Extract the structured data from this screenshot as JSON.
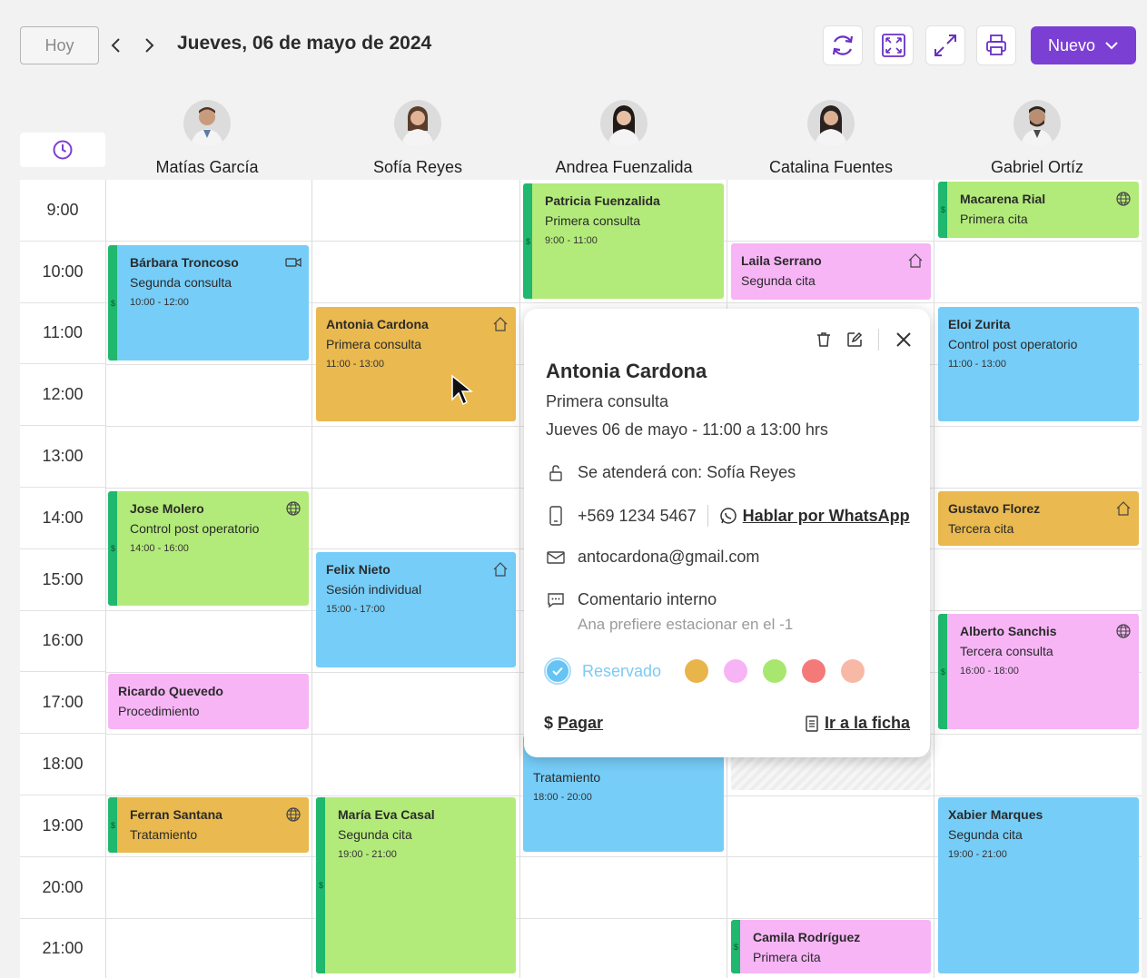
{
  "toolbar": {
    "today_label": "Hoy",
    "date_title": "Jueves, 06 de mayo de 2024",
    "new_label": "Nuevo",
    "icons": [
      "refresh-icon",
      "expand-selection-icon",
      "fullscreen-icon",
      "print-icon"
    ]
  },
  "doctors": [
    {
      "name": "Matías García"
    },
    {
      "name": "Sofía Reyes"
    },
    {
      "name": "Andrea Fuenzalida"
    },
    {
      "name": "Catalina Fuentes"
    },
    {
      "name": "Gabriel Ortíz"
    }
  ],
  "hours": [
    "9:00",
    "10:00",
    "11:00",
    "12:00",
    "13:00",
    "14:00",
    "15:00",
    "16:00",
    "17:00",
    "18:00",
    "19:00",
    "20:00",
    "21:00"
  ],
  "events": {
    "barbara": {
      "name": "Bárbara Troncoso",
      "type": "Segunda consulta",
      "time": "10:00 - 12:00",
      "icon": "video-icon"
    },
    "jose": {
      "name": "Jose Molero",
      "type": "Control post operatorio",
      "time": "14:00 - 16:00",
      "icon": "globe-icon"
    },
    "ricardo": {
      "name": "Ricardo Quevedo",
      "type": "Procedimiento"
    },
    "ferran": {
      "name": "Ferran Santana",
      "type": "Tratamiento",
      "icon": "globe-icon"
    },
    "antonia": {
      "name": "Antonia Cardona",
      "type": "Primera consulta",
      "time": "11:00 - 13:00",
      "icon": "home-icon"
    },
    "felix": {
      "name": "Felix Nieto",
      "type": "Sesión individual",
      "time": "15:00 - 17:00",
      "icon": "home-icon"
    },
    "maria": {
      "name": "María Eva Casal",
      "type": "Segunda cita",
      "time": "19:00 - 21:00"
    },
    "patricia": {
      "name": "Patricia Fuenzalida",
      "type": "Primera consulta",
      "time": "9:00 - 11:00"
    },
    "tratamiento": {
      "type": "Tratamiento",
      "time": "18:00 - 20:00"
    },
    "laila": {
      "name": "Laila Serrano",
      "type": "Segunda cita",
      "icon": "home-icon"
    },
    "camila": {
      "name": "Camila Rodríguez",
      "type": "Primera cita"
    },
    "macarena": {
      "name": "Macarena Rial",
      "type": "Primera cita",
      "icon": "globe-icon"
    },
    "eloi": {
      "name": "Eloi Zurita",
      "type": "Control post operatorio",
      "time": "11:00 - 13:00"
    },
    "gustavo": {
      "name": "Gustavo Florez",
      "type": "Tercera cita",
      "icon": "home-icon"
    },
    "alberto": {
      "name": "Alberto Sanchis",
      "type": "Tercera consulta",
      "time": "16:00 - 18:00",
      "icon": "globe-icon"
    },
    "xabier": {
      "name": "Xabier Marques",
      "type": "Segunda cita",
      "time": "19:00 - 21:00"
    }
  },
  "popup": {
    "title": "Antonia Cardona",
    "type": "Primera consulta",
    "datetime": "Jueves 06 de mayo - 11:00 a 13:00 hrs",
    "attended_by": "Se atenderá con: Sofía Reyes",
    "phone": "+569 1234 5467",
    "whatsapp": "Hablar por WhatsApp",
    "email": "antocardona@gmail.com",
    "comment_label": "Comentario interno",
    "comment": "Ana prefiere estacionar en el -1",
    "status": "Reservado",
    "status_colors": [
      "#e8b54a",
      "#f6b4f5",
      "#a8e76f",
      "#f47a7a",
      "#f7b9a5"
    ],
    "pay_label": "Pagar",
    "pay_symbol": "$",
    "file_label": "Ir a la ficha"
  },
  "colors": {
    "accent": "#7c3fd4",
    "green_event": "#b3eb7a",
    "blue_event": "#76cdf8",
    "pink_event": "#f7b5f6",
    "orange_event": "#eab94f",
    "paid_stripe": "#1fb86e"
  }
}
